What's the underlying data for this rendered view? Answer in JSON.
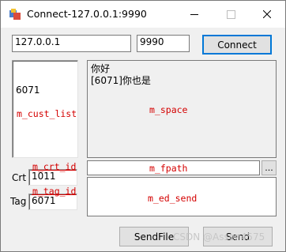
{
  "window": {
    "title": "Connect-127.0.0.1:9990"
  },
  "connection": {
    "ip_value": "127.0.0.1",
    "port_value": "9990",
    "connect_label": "Connect"
  },
  "cust_list": {
    "items": [
      "6071"
    ],
    "control_id": "m_cust_list"
  },
  "space": {
    "lines": [
      "你好",
      "[6071]你也是"
    ],
    "control_id": "m_space"
  },
  "crt": {
    "label": "Crt",
    "value": "1011",
    "control_id": "m_crt_id"
  },
  "tag": {
    "label": "Tag",
    "value": "6071",
    "control_id": "m_tag_id"
  },
  "fpath": {
    "value": "",
    "browse_label": "...",
    "control_id": "m_fpath"
  },
  "ed_send": {
    "value": "",
    "control_id": "m_ed_send"
  },
  "actions": {
    "sendfile_label": "SendFile",
    "send_label": "Send"
  },
  "watermark": "CSDN @Assen4575",
  "icons": {
    "app": "app-icon",
    "minimize": "minimize-icon",
    "maximize": "maximize-icon",
    "close": "close-icon"
  }
}
